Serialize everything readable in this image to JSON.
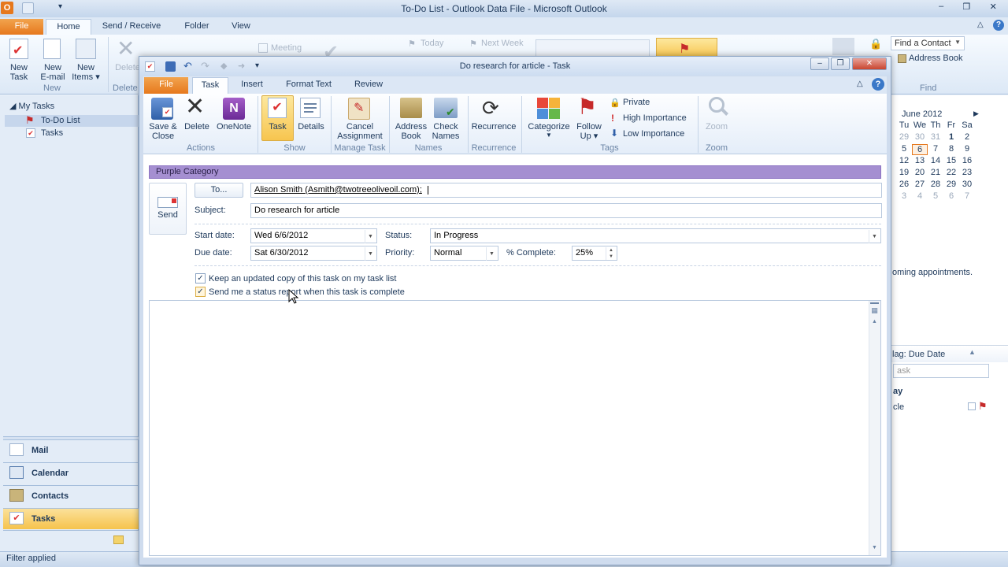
{
  "app": {
    "title": "To-Do List - Outlook Data File - Microsoft Outlook",
    "tabs": [
      "File",
      "Home",
      "Send / Receive",
      "Folder",
      "View"
    ],
    "ribbon": {
      "new_task": "New\nTask",
      "new_email": "New\nE-mail",
      "new_items": "New\nItems ▾",
      "delete": "Delete",
      "meeting": "Meeting",
      "today": "Today",
      "next_week": "Next Week",
      "group_new": "New",
      "group_delete": "Delete",
      "find_contact": "Find a Contact",
      "address_book": "Address Book",
      "group_find": "Find"
    },
    "nav": {
      "my_tasks": "My Tasks",
      "todo_list": "To-Do List",
      "tasks": "Tasks",
      "buttons": [
        "Mail",
        "Calendar",
        "Contacts",
        "Tasks"
      ]
    },
    "status": "Filter applied",
    "calendar": {
      "month": "June 2012",
      "weekdays": [
        "Tu",
        "We",
        "Th",
        "Fr",
        "Sa"
      ],
      "weeks": [
        [
          "29",
          "30",
          "31",
          "1",
          "2"
        ],
        [
          "5",
          "6",
          "7",
          "8",
          "9"
        ],
        [
          "12",
          "13",
          "14",
          "15",
          "16"
        ],
        [
          "19",
          "20",
          "21",
          "22",
          "23"
        ],
        [
          "26",
          "27",
          "28",
          "29",
          "30"
        ],
        [
          "3",
          "4",
          "5",
          "6",
          "7"
        ]
      ]
    },
    "right_pane": {
      "upcoming": "oming appointments.",
      "flag_due": "lag: Due Date",
      "search_placeholder": "ask",
      "row1": "ay",
      "row2": "cle"
    }
  },
  "task_window": {
    "title": "Do research for article  -  Task",
    "tabs": [
      "File",
      "Task",
      "Insert",
      "Format Text",
      "Review"
    ],
    "ribbon": {
      "save_close": "Save &\nClose",
      "delete": "Delete",
      "onenote": "OneNote",
      "task": "Task",
      "details": "Details",
      "cancel_assignment": "Cancel\nAssignment",
      "address_book": "Address\nBook",
      "check_names": "Check\nNames",
      "recurrence": "Recurrence",
      "categorize": "Categorize",
      "follow_up": "Follow\nUp ▾",
      "private": "Private",
      "high_importance": "High Importance",
      "low_importance": "Low Importance",
      "zoom": "Zoom",
      "groups": {
        "actions": "Actions",
        "show": "Show",
        "manage_task": "Manage Task",
        "names": "Names",
        "recurrence": "Recurrence",
        "tags": "Tags",
        "zoom": "Zoom"
      }
    },
    "form": {
      "category": "Purple Category",
      "send": "Send",
      "to_button": "To...",
      "to_value": "Alison Smith (Asmith@twotreeoliveoil.com);",
      "subject_label": "Subject:",
      "subject_value": "Do research for article",
      "start_label": "Start date:",
      "start_value": "Wed 6/6/2012",
      "due_label": "Due date:",
      "due_value": "Sat 6/30/2012",
      "status_label": "Status:",
      "status_value": "In Progress",
      "priority_label": "Priority:",
      "priority_value": "Normal",
      "complete_label": "% Complete:",
      "complete_value": "25%",
      "keep_copy": "Keep an updated copy of this task on my task list",
      "status_report": "Send me a status report when this task is complete"
    }
  },
  "colors": {
    "file_tab": "#e6781d",
    "category": "#a58fd1",
    "selected_button": "#f7c54f"
  }
}
